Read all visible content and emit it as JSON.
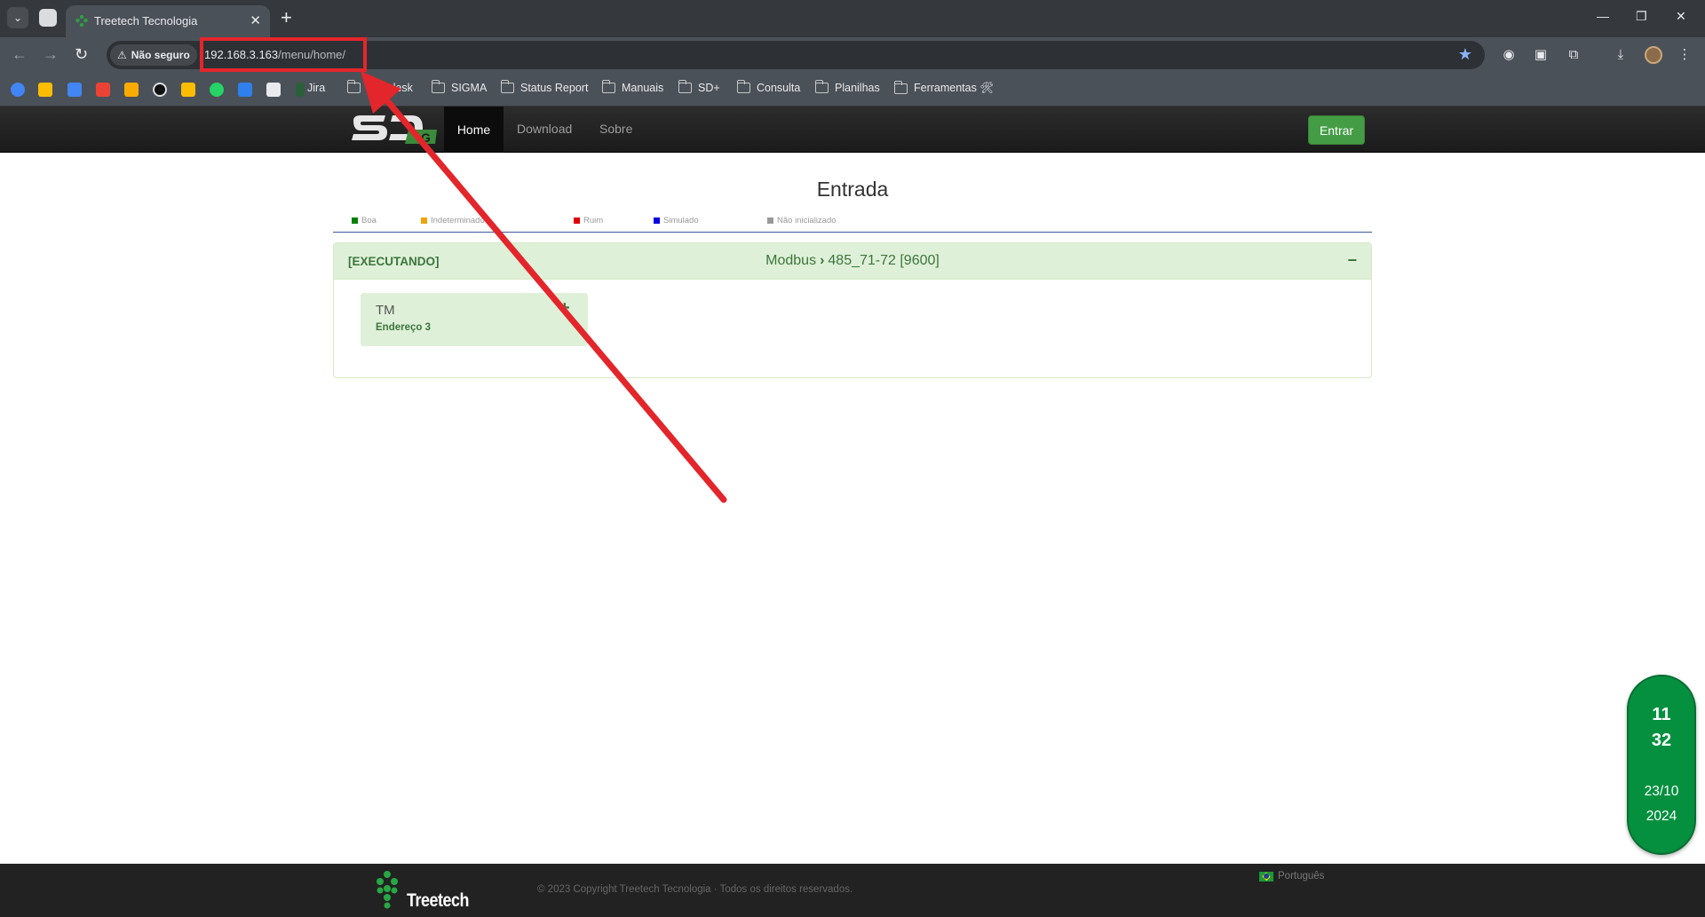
{
  "browser": {
    "tab_title": "Treetech Tecnologia",
    "security_label": "Não seguro",
    "url_host": "192.168.3.163",
    "url_path": "/menu/home/",
    "bookmarks": [
      "Jira",
      "Webdesk",
      "SIGMA",
      "Status Report",
      "Manuais",
      "SD+",
      "Consulta",
      "Planilhas",
      "Ferramentas 🛠"
    ]
  },
  "nav": {
    "items": [
      "Home",
      "Download",
      "Sobre"
    ],
    "login_label": "Entrar"
  },
  "page": {
    "title": "Entrada",
    "legend": [
      {
        "label": "Boa",
        "color": "#008000"
      },
      {
        "label": "Indeterminado",
        "color": "#f0a30a"
      },
      {
        "label": "Ruim",
        "color": "#e00000"
      },
      {
        "label": "Simulado",
        "color": "#0000e0"
      },
      {
        "label": "Não inicializado",
        "color": "#999999"
      }
    ],
    "panel": {
      "status": "[EXECUTANDO]",
      "protocol": "Modbus",
      "port": "485_71-72 [9600]",
      "collapse_symbol": "−"
    },
    "device": {
      "name": "TM",
      "address": "Endereço 3",
      "expand_symbol": "+"
    }
  },
  "clock": {
    "hour": "11",
    "minute": "32",
    "date": "23/10",
    "year": "2024"
  },
  "footer": {
    "brand": "Treetech",
    "copyright": "© 2023 Copyright Treetech Tecnologia · Todos os direitos reservados.",
    "language": "Português"
  },
  "colors": {
    "accent_green": "#449d44",
    "panel_green": "#dff0d8",
    "clock_green": "#04903e",
    "annotation_red": "#e3262b"
  }
}
